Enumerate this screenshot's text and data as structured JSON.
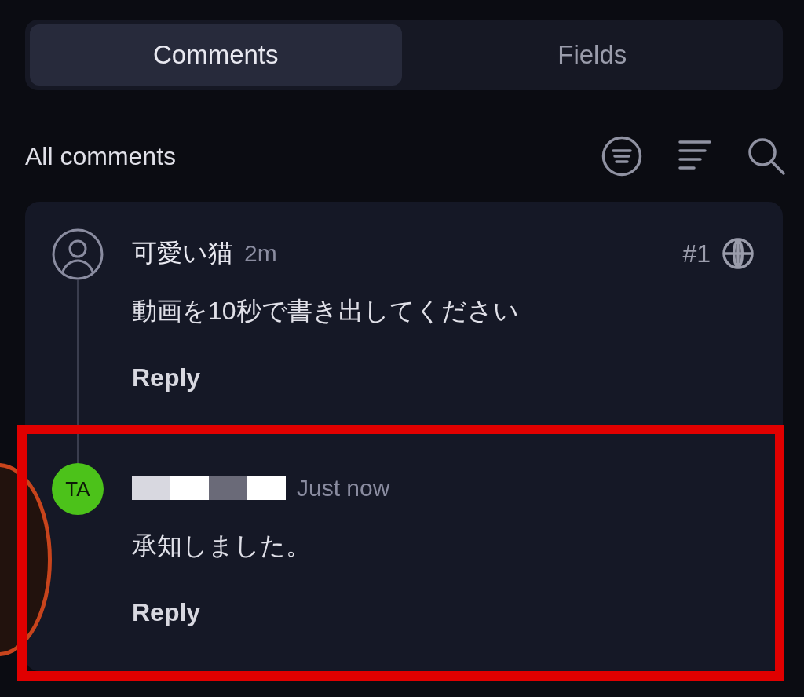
{
  "tabs": [
    {
      "label": "Comments",
      "selected": true
    },
    {
      "label": "Fields",
      "selected": false
    }
  ],
  "header": {
    "title": "All comments"
  },
  "comments": [
    {
      "avatar": {
        "kind": "icon"
      },
      "name_redacted": false,
      "author": "可愛い猫",
      "time": "2m",
      "number": "#1",
      "body": "動画を10秒で書き出してください",
      "reply": "Reply",
      "highlighted": false
    },
    {
      "avatar": {
        "kind": "initials",
        "initials": "TA",
        "color": "#4cc21a"
      },
      "name_redacted": true,
      "time": "Just now",
      "body": "承知しました。",
      "reply": "Reply",
      "highlighted": true
    }
  ]
}
